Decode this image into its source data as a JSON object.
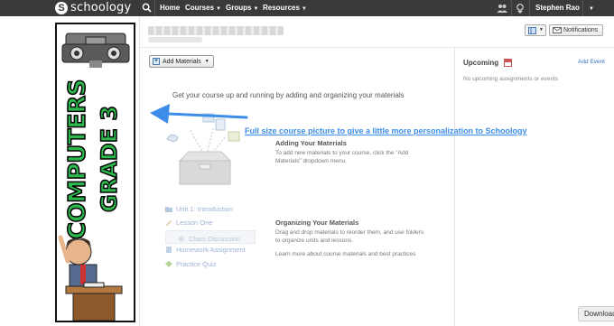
{
  "nav": {
    "logo_text": "schoology",
    "logo_letter": "S",
    "home": "Home",
    "courses": "Courses",
    "groups": "Groups",
    "resources": "Resources",
    "user_name": "Stephen Rao"
  },
  "banner": {
    "word1": "COMPUTERS",
    "word2": "GRADE 3"
  },
  "toolbar": {
    "notifications_label": "Notifications",
    "add_materials_label": "Add Materials"
  },
  "main": {
    "headline": "Get your course up and running by adding and organizing your materials",
    "adding": {
      "title": "Adding Your Materials",
      "body": "To add new materials to your course, click the \"Add Materials\" dropdown menu."
    },
    "organizing": {
      "title": "Organizing Your Materials",
      "body": "Drag and drop materials to reorder them, and use folders to organize units and lessons.",
      "learn_more": "Learn more about course materials and best practices"
    },
    "ghost_items": [
      "Unit 1: Introduction",
      "Lesson One",
      "Class Discussion",
      "Homework Assignment",
      "Practice Quiz"
    ]
  },
  "annotation": "Full size course picture to give a little more personalization to Schoology",
  "sidebar": {
    "upcoming_title": "Upcoming",
    "add_event": "Add Event",
    "empty_text": "No upcoming assignments or events"
  },
  "download_label": "Download",
  "colors": {
    "nav_bg": "#3a3a3a",
    "banner_green": "#2db84d",
    "annotation_blue": "#3d8ee8",
    "link_blue": "#3a72c2"
  }
}
